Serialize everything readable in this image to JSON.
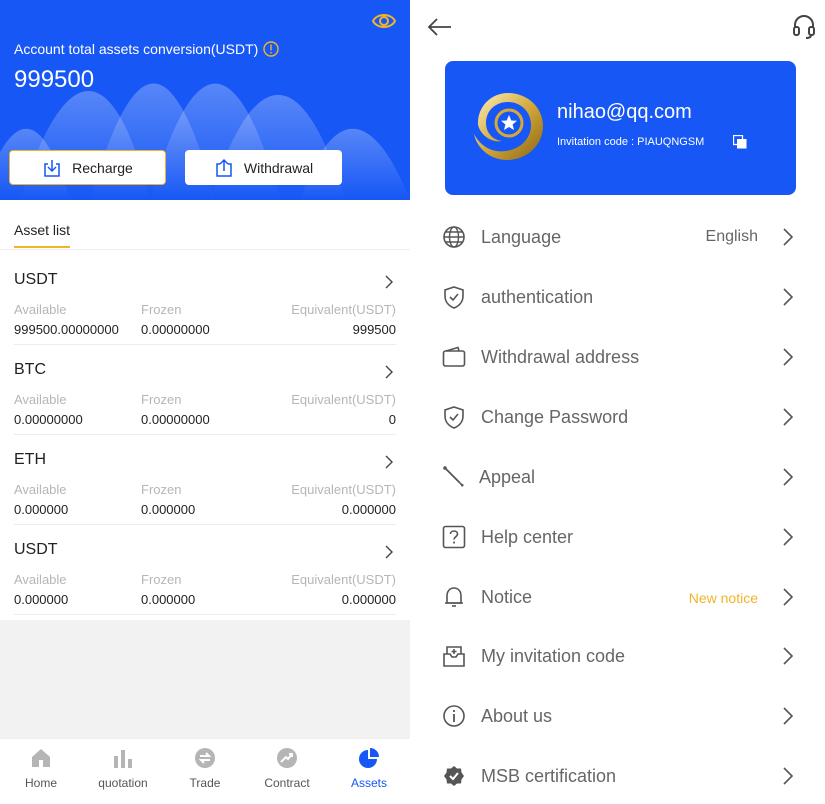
{
  "assets_page": {
    "total_label": "Account total assets conversion(USDT)",
    "total_value": "999500",
    "recharge_label": "Recharge",
    "withdraw_label": "Withdrawal",
    "list_tab": "Asset list",
    "col_available": "Available",
    "col_frozen": "Frozen",
    "col_equivalent": "Equivalent(USDT)",
    "assets": [
      {
        "name": "USDT",
        "available": "999500.00000000",
        "frozen": "0.00000000",
        "equivalent": "999500"
      },
      {
        "name": "BTC",
        "available": "0.00000000",
        "frozen": "0.00000000",
        "equivalent": "0"
      },
      {
        "name": "ETH",
        "available": "0.000000",
        "frozen": "0.000000",
        "equivalent": "0.000000"
      },
      {
        "name": "USDT",
        "available": "0.000000",
        "frozen": "0.000000",
        "equivalent": "0.000000"
      }
    ]
  },
  "tabbar": {
    "items": [
      {
        "label": "Home",
        "icon": "home-icon"
      },
      {
        "label": "quotation",
        "icon": "bar-chart-icon"
      },
      {
        "label": "Trade",
        "icon": "trade-icon"
      },
      {
        "label": "Contract",
        "icon": "trend-up-icon"
      },
      {
        "label": "Assets",
        "icon": "pie-chart-icon",
        "active": true
      }
    ]
  },
  "profile": {
    "email": "nihao@qq.com",
    "invite_text": "Invitation code : PIAUQNGSM"
  },
  "menu": [
    {
      "label": "Language",
      "value": "English",
      "icon": "globe-icon"
    },
    {
      "label": "authentication",
      "icon": "shield-icon"
    },
    {
      "label": "Withdrawal address",
      "icon": "wallet-icon"
    },
    {
      "label": "Change Password",
      "icon": "shield-check-icon"
    },
    {
      "label": "Appeal",
      "icon": "pen-icon"
    },
    {
      "label": "Help center",
      "icon": "question-icon"
    },
    {
      "label": "Notice",
      "value": "New notice",
      "icon": "bell-icon"
    },
    {
      "label": "My invitation code",
      "icon": "inbox-icon"
    },
    {
      "label": "About us",
      "icon": "info-icon"
    },
    {
      "label": "MSB certification",
      "icon": "badge-icon"
    }
  ],
  "colors": {
    "brand_blue": "#1657f5",
    "accent_yellow": "#f0b429"
  }
}
